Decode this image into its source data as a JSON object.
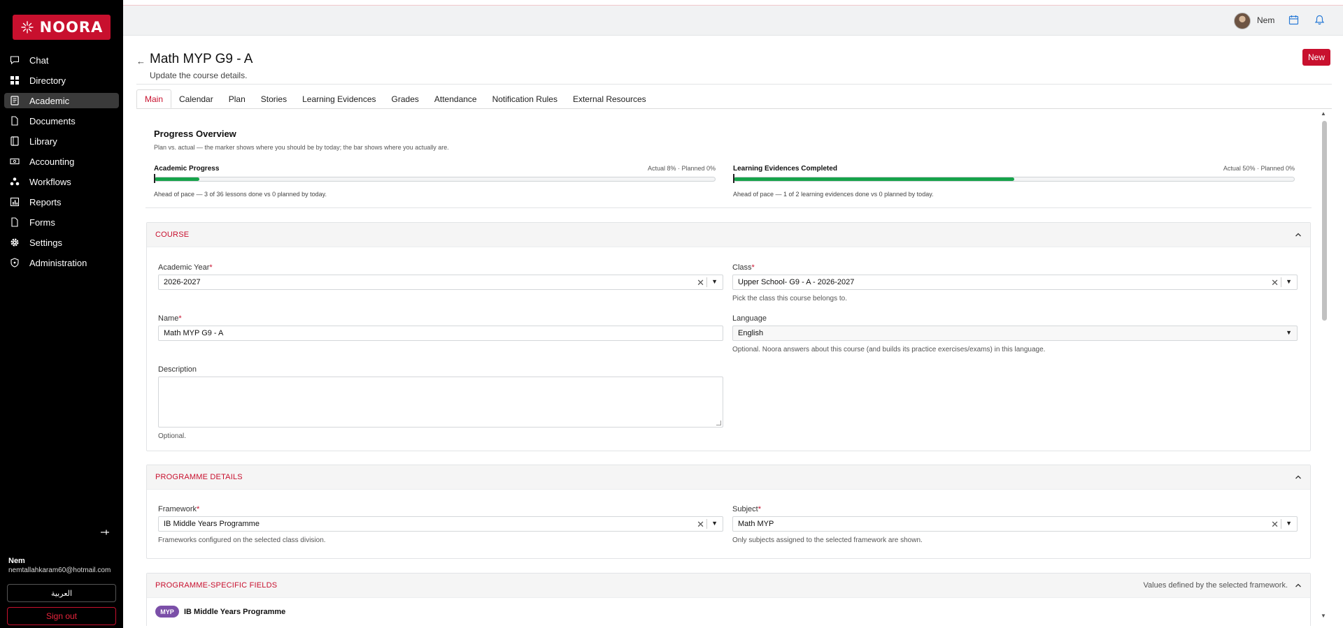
{
  "brand": {
    "name": "NOORA",
    "color": "#c8102e"
  },
  "sidebar": {
    "items": [
      {
        "label": "Chat",
        "icon": "chat-icon"
      },
      {
        "label": "Directory",
        "icon": "grid-icon"
      },
      {
        "label": "Academic",
        "icon": "book-icon",
        "active": true
      },
      {
        "label": "Documents",
        "icon": "document-icon"
      },
      {
        "label": "Library",
        "icon": "library-icon"
      },
      {
        "label": "Accounting",
        "icon": "money-icon"
      },
      {
        "label": "Workflows",
        "icon": "workflow-icon"
      },
      {
        "label": "Reports",
        "icon": "report-icon"
      },
      {
        "label": "Forms",
        "icon": "form-icon"
      },
      {
        "label": "Settings",
        "icon": "gear-icon"
      },
      {
        "label": "Administration",
        "icon": "shield-icon"
      }
    ],
    "user": {
      "name": "Nem",
      "email": "nemtallahkaram60@hotmail.com"
    },
    "language_button": "العربية",
    "sign_out": "Sign out"
  },
  "topbar": {
    "user_name": "Nem"
  },
  "header": {
    "title": "Math MYP G9 - A",
    "subtitle": "Update the course details.",
    "new_button": "New"
  },
  "tabs": [
    {
      "label": "Main",
      "active": true
    },
    {
      "label": "Calendar"
    },
    {
      "label": "Plan"
    },
    {
      "label": "Stories"
    },
    {
      "label": "Learning Evidences"
    },
    {
      "label": "Grades"
    },
    {
      "label": "Attendance"
    },
    {
      "label": "Notification Rules"
    },
    {
      "label": "External Resources"
    }
  ],
  "progress": {
    "title": "Progress Overview",
    "subtitle": "Plan vs. actual — the marker shows where you should be by today; the bar shows where you actually are.",
    "academic": {
      "title": "Academic Progress",
      "stats": "Actual 8% · Planned 0%",
      "actual_pct": 8,
      "planned_pct": 0,
      "note": "Ahead of pace — 3 of 36 lessons done vs 0 planned by today."
    },
    "evidences": {
      "title": "Learning Evidences Completed",
      "stats": "Actual 50% · Planned 0%",
      "actual_pct": 50,
      "planned_pct": 0,
      "note": "Ahead of pace — 1 of 2 learning evidences done vs 0 planned by today."
    },
    "bar_color": "#16a34a"
  },
  "course": {
    "section_title": "COURSE",
    "academic_year": {
      "label": "Academic Year",
      "value": "2026-2027"
    },
    "class": {
      "label": "Class",
      "value": "Upper School- G9 - A - 2026-2027",
      "help": "Pick the class this course belongs to."
    },
    "name": {
      "label": "Name",
      "value": "Math MYP G9 - A"
    },
    "language": {
      "label": "Language",
      "value": "English",
      "help": "Optional. Noora answers about this course (and builds its practice exercises/exams) in this language."
    },
    "description": {
      "label": "Description",
      "value": "",
      "help": "Optional."
    }
  },
  "programme": {
    "section_title": "PROGRAMME DETAILS",
    "framework": {
      "label": "Framework",
      "value": "IB Middle Years Programme",
      "help": "Frameworks configured on the selected class division."
    },
    "subject": {
      "label": "Subject",
      "value": "Math MYP",
      "help": "Only subjects assigned to the selected framework are shown."
    }
  },
  "programme_specific": {
    "section_title": "PROGRAMME-SPECIFIC FIELDS",
    "note": "Values defined by the selected framework.",
    "badge": "MYP",
    "programme_name": "IB Middle Years Programme",
    "badge_color": "#7b4fa8"
  },
  "required_mark": "*",
  "clear_glyph": "✕",
  "dropdown_glyph": "▼"
}
